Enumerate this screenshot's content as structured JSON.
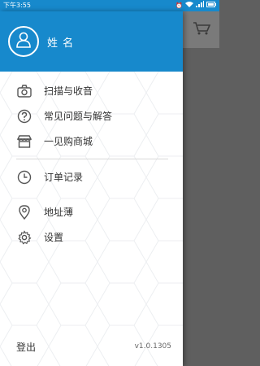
{
  "status_bar": {
    "time": "下午3:55",
    "icons": [
      "alarm-icon",
      "wifi-icon",
      "signal-icon",
      "battery-icon"
    ]
  },
  "drawer": {
    "header": {
      "avatar_icon": "person-icon",
      "username": "姓 名",
      "background_color": "#1789cc"
    },
    "menu_groups": [
      [
        {
          "label": "扫描与收音",
          "icon": "camera-icon"
        },
        {
          "label": "常见问题与解答",
          "icon": "question-icon"
        },
        {
          "label": "一见购商城",
          "icon": "store-icon"
        }
      ],
      [
        {
          "label": "订单记录",
          "icon": "clock-icon"
        }
      ],
      [
        {
          "label": "地址薄",
          "icon": "location-pin-icon"
        },
        {
          "label": "设置",
          "icon": "gear-icon"
        }
      ]
    ],
    "footer": {
      "logout_label": "登出",
      "version": "v1.0.1305"
    }
  },
  "background_app": {
    "header_icon": "shopping-cart-icon"
  }
}
